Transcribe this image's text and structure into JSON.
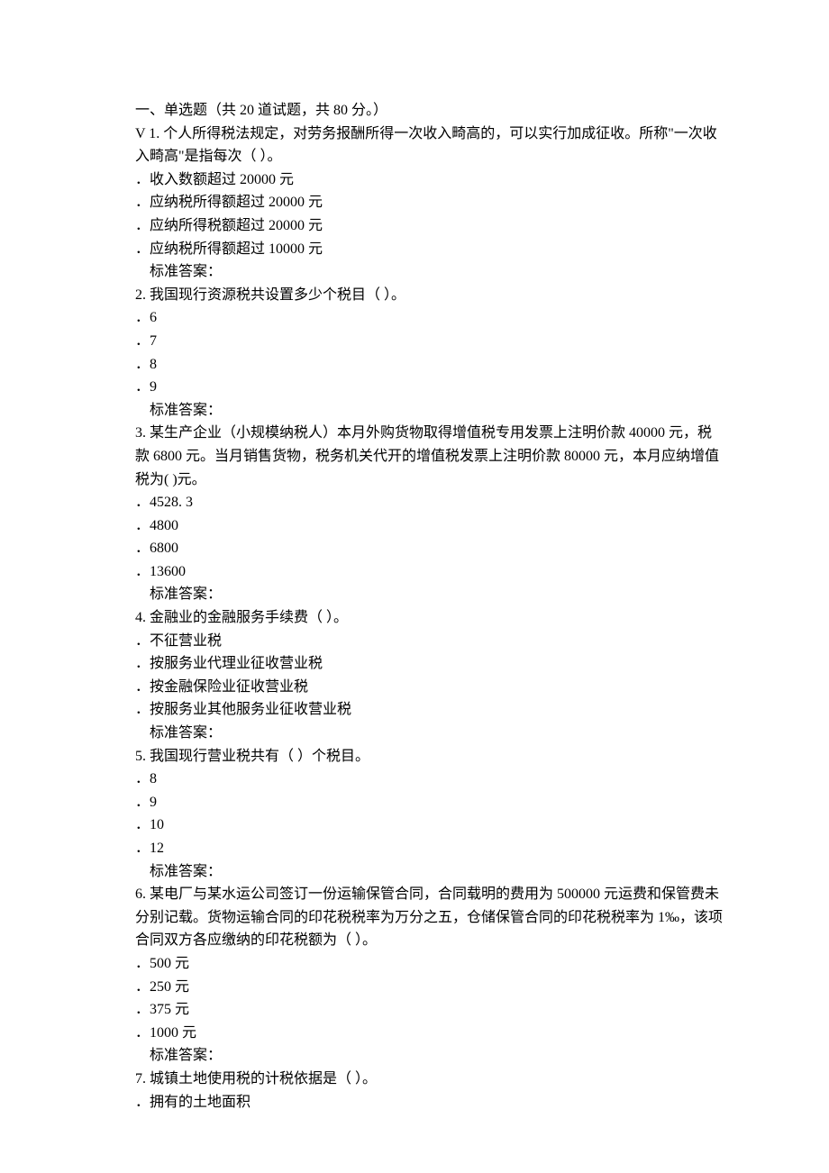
{
  "header": "一、单选题（共 20 道试题，共 80 分。）",
  "questions": [
    {
      "num": "V 1.",
      "text": "  个人所得税法规定，对劳务报酬所得一次收入畸高的，可以实行加成征收。所称\"一次收入畸高\"是指每次（ ）。",
      "options": [
        "收入数额超过 20000 元",
        "应纳税所得额超过 20000 元",
        "应纳所得税额超过 20000 元",
        "应纳税所得额超过 10000 元"
      ],
      "answer_label": "标准答案："
    },
    {
      "num": "2.",
      "text": "  我国现行资源税共设置多少个税目（ ）。",
      "options": [
        "6",
        "7",
        "8",
        "9"
      ],
      "answer_label": "标准答案："
    },
    {
      "num": "3.",
      "text": "  某生产企业（小规模纳税人）本月外购货物取得增值税专用发票上注明价款 40000 元，税款 6800 元。当月销售货物，税务机关代开的增值税发票上注明价款 80000 元，本月应纳增值税为( )元。",
      "options": [
        "4528. 3",
        "4800",
        "6800",
        "13600"
      ],
      "answer_label": "标准答案："
    },
    {
      "num": "4.",
      "text": "  金融业的金融服务手续费（ ）。",
      "options": [
        "不征营业税",
        "按服务业代理业征收营业税",
        "按金融保险业征收营业税",
        "按服务业其他服务业征收营业税"
      ],
      "answer_label": "标准答案："
    },
    {
      "num": "5.",
      "text": "  我国现行营业税共有（ ）个税目。",
      "options": [
        "8",
        "9",
        "10",
        "12"
      ],
      "answer_label": "标准答案："
    },
    {
      "num": "6.",
      "text": "  某电厂与某水运公司签订一份运输保管合同，合同载明的费用为 500000 元运费和保管费未分别记载。货物运输合同的印花税税率为万分之五，仓储保管合同的印花税税率为 1‰，该项合同双方各应缴纳的印花税额为（ ）。",
      "options": [
        "500 元",
        "250 元",
        "375 元",
        "1000 元"
      ],
      "answer_label": "标准答案："
    },
    {
      "num": "7.",
      "text": "  城镇土地使用税的计税依据是（ ）。",
      "options": [
        "拥有的土地面积"
      ],
      "answer_label": ""
    }
  ],
  "option_prefix": "．"
}
